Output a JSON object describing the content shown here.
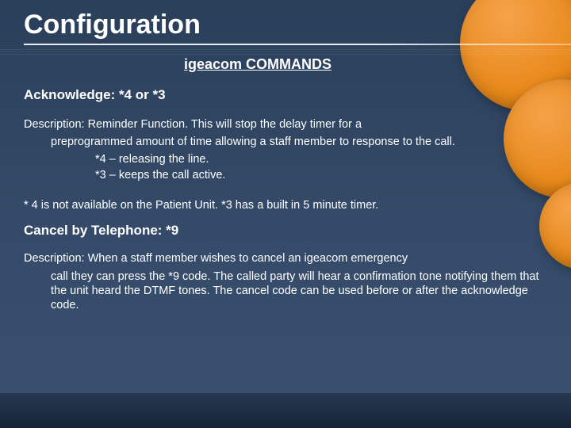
{
  "title": "Configuration",
  "subtitle": "igeacom COMMANDS",
  "acknowledge": {
    "heading": "Acknowledge:  *4 or *3",
    "desc_lead": "Description:  Reminder Function.  This will stop the delay timer for a",
    "desc_cont": "preprogrammed amount of time allowing a staff member to response to the call.",
    "opt4": "*4 – releasing the line.",
    "opt3": "*3 – keeps the call active.",
    "note": "* 4 is not available on the Patient Unit.  *3 has a built in 5 minute timer."
  },
  "cancel": {
    "heading": "Cancel by Telephone:  *9",
    "desc_lead": "Description:  When a staff member wishes to cancel an igeacom emergency",
    "desc_cont": "call they can press the *9 code.  The called party will hear a confirmation tone notifying them that the unit heard the DTMF tones.  The cancel code can be used before or after the acknowledge code."
  }
}
